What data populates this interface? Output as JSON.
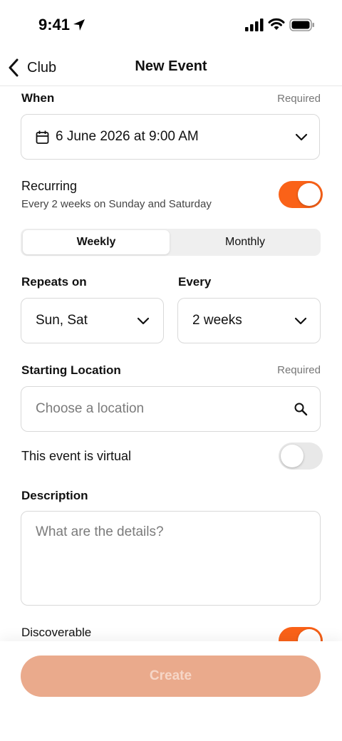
{
  "status_bar": {
    "time": "9:41"
  },
  "nav": {
    "back_label": "Club",
    "title": "New Event"
  },
  "when": {
    "label": "When",
    "required": "Required",
    "value": "6 June 2026 at 9:00 AM"
  },
  "recurring": {
    "label": "Recurring",
    "description": "Every 2 weeks on Sunday and Saturday",
    "enabled": true
  },
  "frequency_tabs": [
    {
      "label": "Weekly",
      "active": true
    },
    {
      "label": "Monthly",
      "active": false
    }
  ],
  "repeats_on": {
    "label": "Repeats on",
    "value": "Sun, Sat"
  },
  "every": {
    "label": "Every",
    "value": "2 weeks"
  },
  "starting_location": {
    "label": "Starting Location",
    "required": "Required",
    "placeholder": "Choose a location"
  },
  "virtual": {
    "label": "This event is virtual",
    "enabled": false
  },
  "description": {
    "label": "Description",
    "placeholder": "What are the details?"
  },
  "discoverable": {
    "label": "Discoverable",
    "enabled": true
  },
  "create_button": {
    "label": "Create"
  },
  "colors": {
    "accent": "#fa6218",
    "create_disabled_bg": "#eaaa8c",
    "toggle_off": "#e8e8e8"
  }
}
